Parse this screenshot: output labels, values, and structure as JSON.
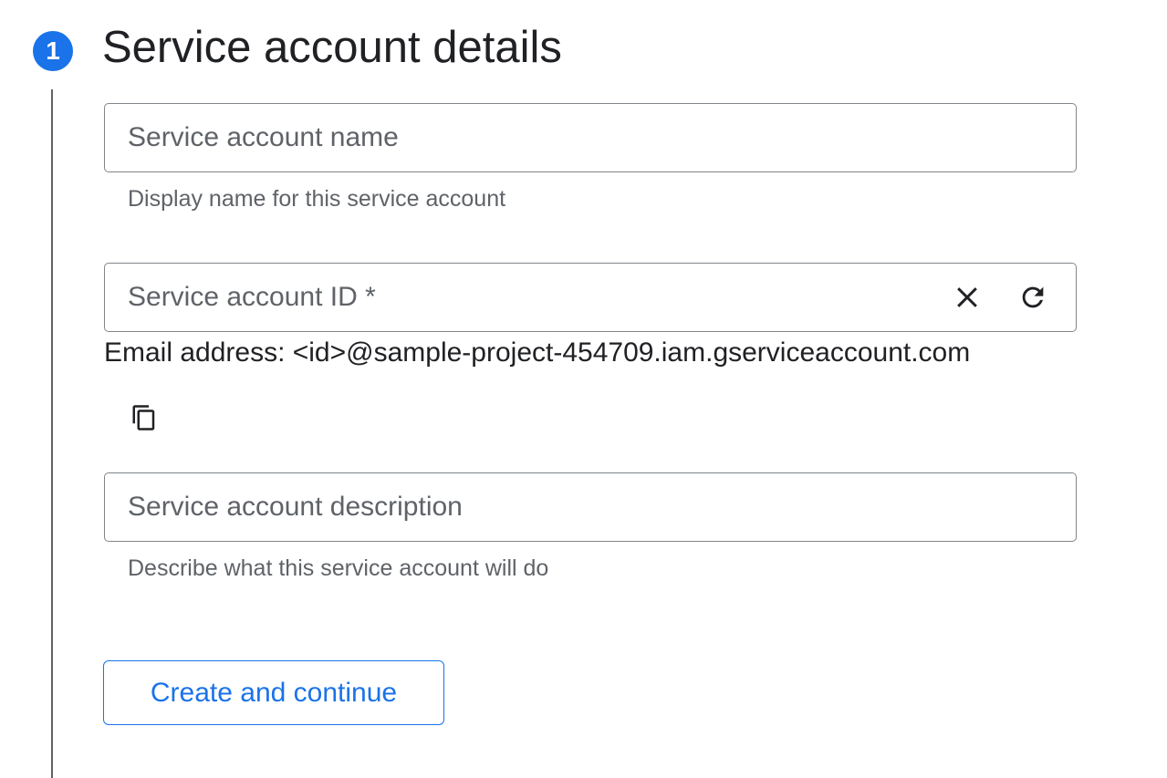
{
  "step": {
    "number": "1",
    "title": "Service account details"
  },
  "fields": {
    "name": {
      "placeholder": "Service account name",
      "value": "",
      "hint": "Display name for this service account"
    },
    "id": {
      "placeholder": "Service account ID *",
      "value": "",
      "clear_icon": "close-icon",
      "refresh_icon": "refresh-icon"
    },
    "description": {
      "placeholder": "Service account description",
      "value": "",
      "hint": "Describe what this service account will do"
    }
  },
  "email": {
    "text": "Email address: <id>@sample-project-454709.iam.gserviceaccount.com",
    "copy_icon": "copy-icon"
  },
  "actions": {
    "create_label": "Create and continue"
  },
  "colors": {
    "accent": "#1a73e8",
    "text_primary": "#202124",
    "text_secondary": "#5f6368",
    "border": "#80868b"
  }
}
